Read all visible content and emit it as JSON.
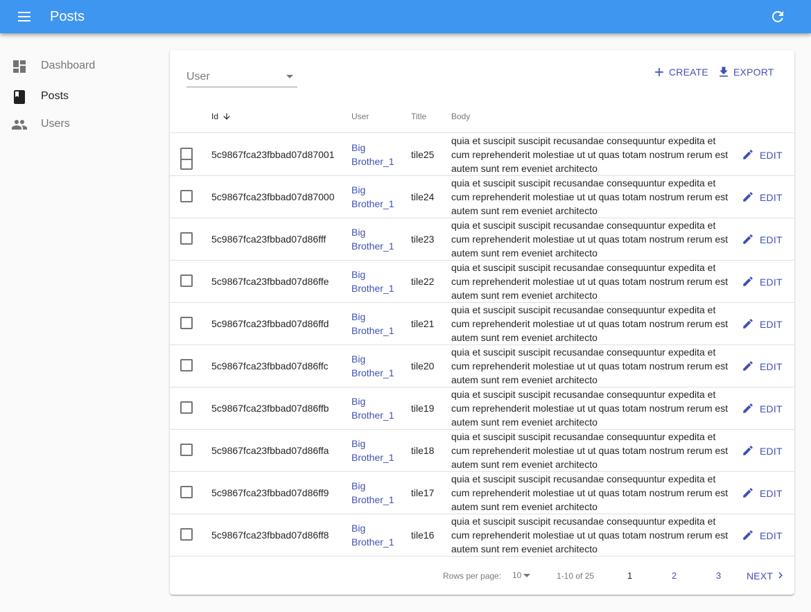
{
  "appbar": {
    "title": "Posts"
  },
  "sidebar": {
    "items": [
      {
        "label": "Dashboard",
        "icon": "dashboard-icon"
      },
      {
        "label": "Posts",
        "icon": "book-icon",
        "active": true
      },
      {
        "label": "Users",
        "icon": "people-icon"
      }
    ]
  },
  "filters": {
    "user_label": "User"
  },
  "toolbar": {
    "create_label": "CREATE",
    "export_label": "EXPORT"
  },
  "table": {
    "headers": {
      "id": "Id",
      "user": "User",
      "title": "Title",
      "body": "Body"
    },
    "sort": {
      "field": "Id",
      "direction": "descending"
    },
    "edit_label": "EDIT",
    "rows": [
      {
        "id": "5c9867fca23fbbad07d87001",
        "user": "Big Brother_1",
        "title": "tile25",
        "body": "quia et suscipit suscipit recusandae consequuntur expedita et cum reprehenderit molestiae ut ut quas totam nostrum rerum est autem sunt rem eveniet architecto"
      },
      {
        "id": "5c9867fca23fbbad07d87000",
        "user": "Big Brother_1",
        "title": "tile24",
        "body": "quia et suscipit suscipit recusandae consequuntur expedita et cum reprehenderit molestiae ut ut quas totam nostrum rerum est autem sunt rem eveniet architecto"
      },
      {
        "id": "5c9867fca23fbbad07d86fff",
        "user": "Big Brother_1",
        "title": "tile23",
        "body": "quia et suscipit suscipit recusandae consequuntur expedita et cum reprehenderit molestiae ut ut quas totam nostrum rerum est autem sunt rem eveniet architecto"
      },
      {
        "id": "5c9867fca23fbbad07d86ffe",
        "user": "Big Brother_1",
        "title": "tile22",
        "body": "quia et suscipit suscipit recusandae consequuntur expedita et cum reprehenderit molestiae ut ut quas totam nostrum rerum est autem sunt rem eveniet architecto"
      },
      {
        "id": "5c9867fca23fbbad07d86ffd",
        "user": "Big Brother_1",
        "title": "tile21",
        "body": "quia et suscipit suscipit recusandae consequuntur expedita et cum reprehenderit molestiae ut ut quas totam nostrum rerum est autem sunt rem eveniet architecto"
      },
      {
        "id": "5c9867fca23fbbad07d86ffc",
        "user": "Big Brother_1",
        "title": "tile20",
        "body": "quia et suscipit suscipit recusandae consequuntur expedita et cum reprehenderit molestiae ut ut quas totam nostrum rerum est autem sunt rem eveniet architecto"
      },
      {
        "id": "5c9867fca23fbbad07d86ffb",
        "user": "Big Brother_1",
        "title": "tile19",
        "body": "quia et suscipit suscipit recusandae consequuntur expedita et cum reprehenderit molestiae ut ut quas totam nostrum rerum est autem sunt rem eveniet architecto"
      },
      {
        "id": "5c9867fca23fbbad07d86ffa",
        "user": "Big Brother_1",
        "title": "tile18",
        "body": "quia et suscipit suscipit recusandae consequuntur expedita et cum reprehenderit molestiae ut ut quas totam nostrum rerum est autem sunt rem eveniet architecto"
      },
      {
        "id": "5c9867fca23fbbad07d86ff9",
        "user": "Big Brother_1",
        "title": "tile17",
        "body": "quia et suscipit suscipit recusandae consequuntur expedita et cum reprehenderit molestiae ut ut quas totam nostrum rerum est autem sunt rem eveniet architecto"
      },
      {
        "id": "5c9867fca23fbbad07d86ff8",
        "user": "Big Brother_1",
        "title": "tile16",
        "body": "quia et suscipit suscipit recusandae consequuntur expedita et cum reprehenderit molestiae ut ut quas totam nostrum rerum est autem sunt rem eveniet architecto"
      }
    ]
  },
  "pagination": {
    "rows_per_page_label": "Rows per page:",
    "rows_per_page": "10",
    "range": "1-10 of 25",
    "pages": [
      "1",
      "2",
      "3"
    ],
    "current_page": "1",
    "next_label": "NEXT"
  },
  "colors": {
    "appbar": "#3f96f0",
    "accent": "#3f51b5"
  }
}
